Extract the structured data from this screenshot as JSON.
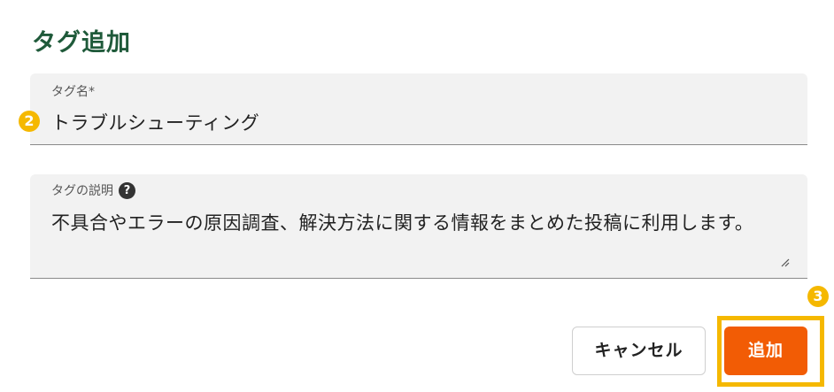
{
  "dialog": {
    "title": "タグ追加"
  },
  "tag_name_field": {
    "label": "タグ名*",
    "value": "トラブルシューティング"
  },
  "tag_description_field": {
    "label": "タグの説明",
    "help_icon": "question-circle-icon",
    "help_glyph": "?",
    "value": "不具合やエラーの原因調査、解決方法に関する情報をまとめた投稿に利用します。",
    "resize_icon": "resize-handle-icon"
  },
  "actions": {
    "cancel_label": "キャンセル",
    "add_label": "追加"
  },
  "annotations": {
    "step_2": "2",
    "step_3": "3",
    "color": "#f5b800"
  },
  "colors": {
    "title": "#1f5a3a",
    "primary_button": "#f25c05",
    "field_background": "#f2f2f2"
  }
}
